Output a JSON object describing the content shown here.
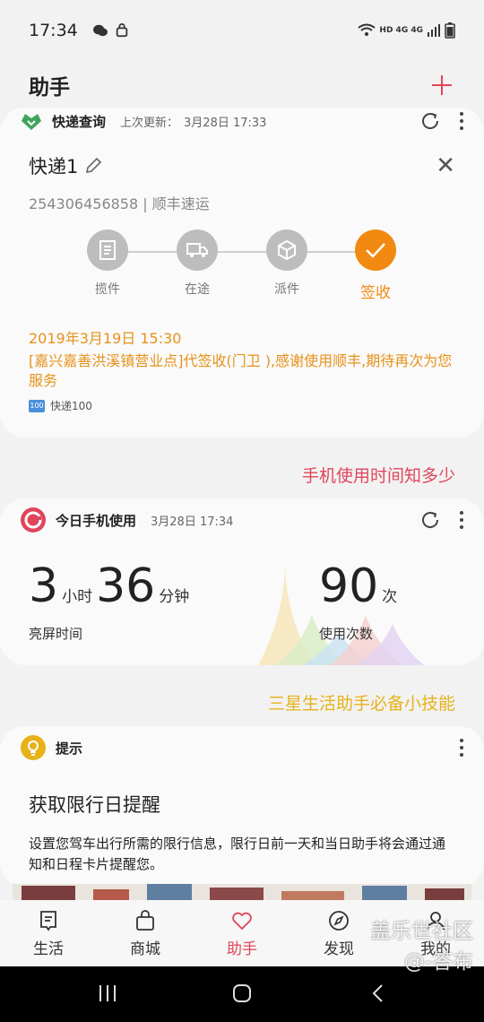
{
  "status_bar": {
    "time": "17:34",
    "network": "HD 4G 4G"
  },
  "header": {
    "title": "助手"
  },
  "express_card": {
    "service": "快递查询",
    "last_update_label": "上次更新：",
    "last_update": "3月28日 17:33",
    "name": "快递1",
    "tracking": "254306456858 | 顺丰速运",
    "steps": [
      "揽件",
      "在途",
      "派件",
      "签收"
    ],
    "date": "2019年3月19日 15:30",
    "message": "[嘉兴嘉善洪溪镇营业点]代签收(门卫 ),感谢使用顺丰,期待再次为您服务",
    "source": "快递100",
    "source_logo": "100"
  },
  "section1_link": "手机使用时间知多少",
  "usage_card": {
    "title": "今日手机使用",
    "time": "3月28日 17:34",
    "hours": "3",
    "hours_unit": "小时",
    "minutes": "36",
    "minutes_unit": "分钟",
    "screen_label": "亮屏时间",
    "count": "90",
    "count_unit": "次",
    "count_label": "使用次数"
  },
  "section2_link": "三星生活助手必备小技能",
  "tip_card": {
    "title": "提示",
    "heading": "获取限行日提醒",
    "body": "设置您驾车出行所需的限行信息，限行日前一天和当日助手将会通过通知和日程卡片提醒您。"
  },
  "bottom_nav": [
    {
      "label": "生活",
      "icon": "life-icon"
    },
    {
      "label": "商城",
      "icon": "shop-icon"
    },
    {
      "label": "助手",
      "icon": "heart-icon",
      "active": true
    },
    {
      "label": "发现",
      "icon": "compass-icon"
    },
    {
      "label": "我的",
      "icon": "profile-icon"
    }
  ],
  "watermark": {
    "line1": "盖乐世社区",
    "line2": "@-答布"
  },
  "colors": {
    "accent": "#e0455b",
    "orange": "#f28a12",
    "yellow": "#e7b21a",
    "green": "#3fa45b"
  }
}
